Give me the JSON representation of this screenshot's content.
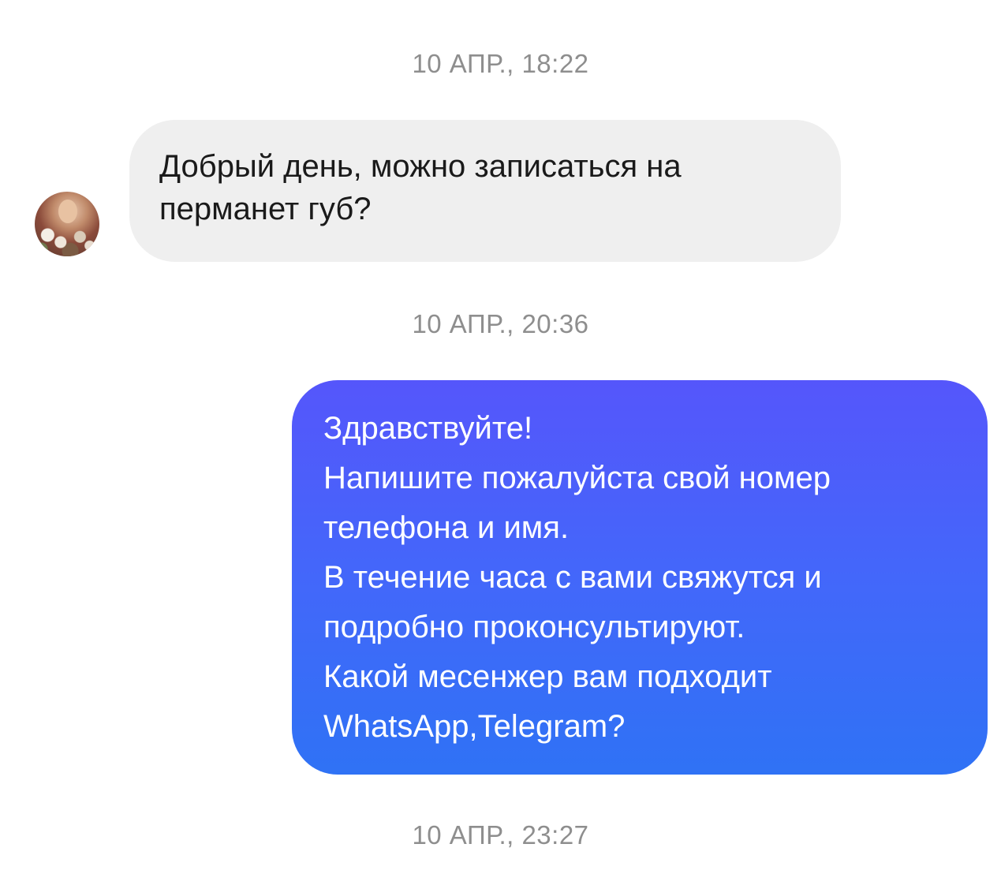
{
  "timestamps": [
    "10 АПР., 18:22",
    "10 АПР., 20:36",
    "10 АПР., 23:27"
  ],
  "incoming": {
    "avatar_icon": "user-avatar-photo",
    "lines": [
      "Добрый день, можно записаться на",
      "перманет губ?"
    ]
  },
  "outgoing": {
    "lines": [
      "Здравствуйте!",
      "Напишите пожалуйста свой номер",
      "телефона и имя.",
      "В течение часа с вами свяжутся и",
      "подробно проконсультируют.",
      "Какой месенжер вам подходит",
      "WhatsApp,Telegram?"
    ]
  },
  "colors": {
    "incoming_bubble": "#efefef",
    "outgoing_gradient_top": "#5556fb",
    "outgoing_gradient_bottom": "#2f72f5",
    "timestamp": "#8e8e8e"
  }
}
